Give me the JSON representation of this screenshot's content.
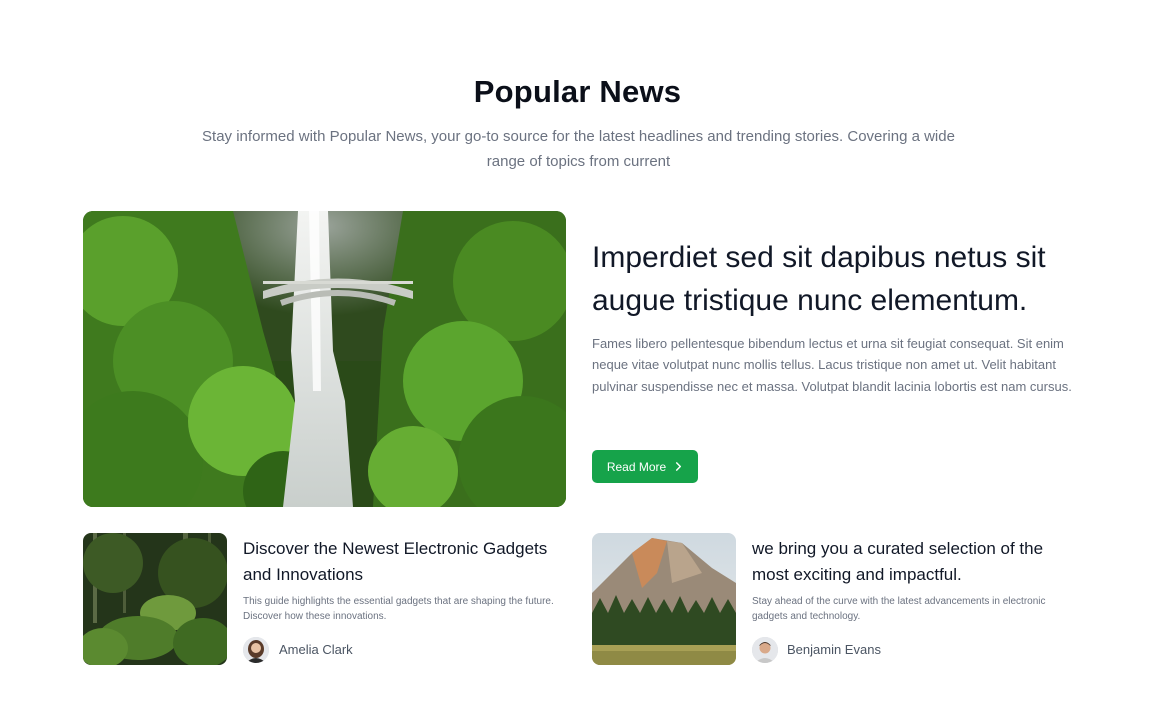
{
  "section": {
    "title": "Popular News",
    "subtitle": "Stay informed with Popular News, your go-to source for the latest headlines and trending stories. Covering a wide range of topics from current"
  },
  "featured": {
    "image": "waterfall-bridge-photo",
    "title": "Imperdiet sed sit dapibus netus sit augue tristique nunc elementum.",
    "body": "Fames libero pellentesque bibendum lectus et urna sit feugiat consequat. Sit enim neque vitae volutpat nunc mollis tellus. Lacus tristique non amet ut. Velit habitant pulvinar suspendisse nec et massa. Volutpat blandit lacinia lobortis est nam cursus.",
    "button_label": "Read More",
    "button_icon": "chevron-right-icon",
    "accent": "#16a34a"
  },
  "cards": [
    {
      "image": "jungle-photo",
      "title": "Discover the Newest Electronic Gadgets and Innovations",
      "description": "This guide highlights the essential gadgets that are shaping the future. Discover how these innovations.",
      "author": "Amelia Clark"
    },
    {
      "image": "mountain-forest-photo",
      "title": "we bring you a curated selection of the most exciting and impactful.",
      "description": "Stay ahead of the curve with the latest advancements in electronic gadgets and technology.",
      "author": "Benjamin Evans"
    }
  ]
}
